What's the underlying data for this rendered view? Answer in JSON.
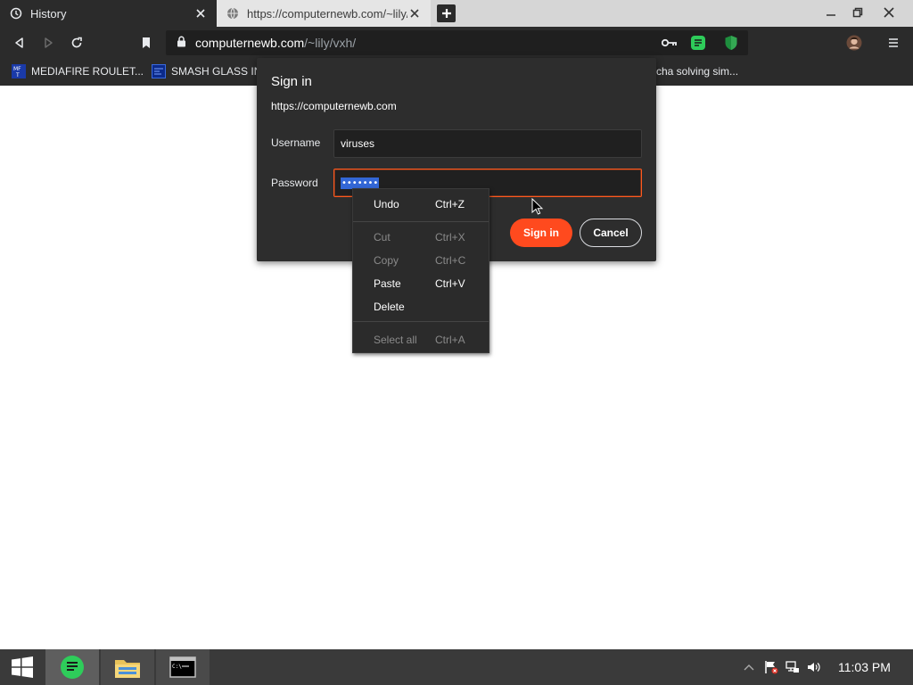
{
  "browser": {
    "tabs": [
      {
        "title": "History",
        "icon": "history-icon",
        "active": true
      },
      {
        "title": "https://computernewb.com/~lily/v",
        "icon": "globe-icon",
        "active": false
      }
    ],
    "address": {
      "host": "computernewb.com",
      "path": "/~lily/vxh/"
    },
    "bookmarks": [
      {
        "label": "MEDIAFIRE ROULET...",
        "icon": "mediafire-favicon"
      },
      {
        "label": "SMASH GLASS IN",
        "icon": "smash-glass-favicon"
      },
      {
        "label": "cha solving sim...",
        "icon": "bookmark-favicon"
      }
    ]
  },
  "dialog": {
    "title": "Sign in",
    "origin": "https://computernewb.com",
    "username_label": "Username",
    "username_value": "viruses",
    "password_label": "Password",
    "password_mask": "•••••••",
    "signin_label": "Sign in",
    "cancel_label": "Cancel"
  },
  "context_menu": {
    "items": [
      {
        "label": "Undo",
        "shortcut": "Ctrl+Z",
        "enabled": true
      },
      {
        "label": "Cut",
        "shortcut": "Ctrl+X",
        "enabled": false
      },
      {
        "label": "Copy",
        "shortcut": "Ctrl+C",
        "enabled": false
      },
      {
        "label": "Paste",
        "shortcut": "Ctrl+V",
        "enabled": true
      },
      {
        "label": "Delete",
        "shortcut": "",
        "enabled": true
      },
      {
        "label": "Select all",
        "shortcut": "Ctrl+A",
        "enabled": false
      }
    ]
  },
  "taskbar": {
    "clock": "11:03 PM",
    "apps": [
      "start-icon",
      "notepad-icon",
      "file-explorer-icon",
      "command-prompt-icon"
    ]
  },
  "colors": {
    "accent": "#ff4a1e",
    "selection": "#3367d6",
    "chrome_dark": "#2b2b2b",
    "taskbar": "#3a3a3a"
  }
}
